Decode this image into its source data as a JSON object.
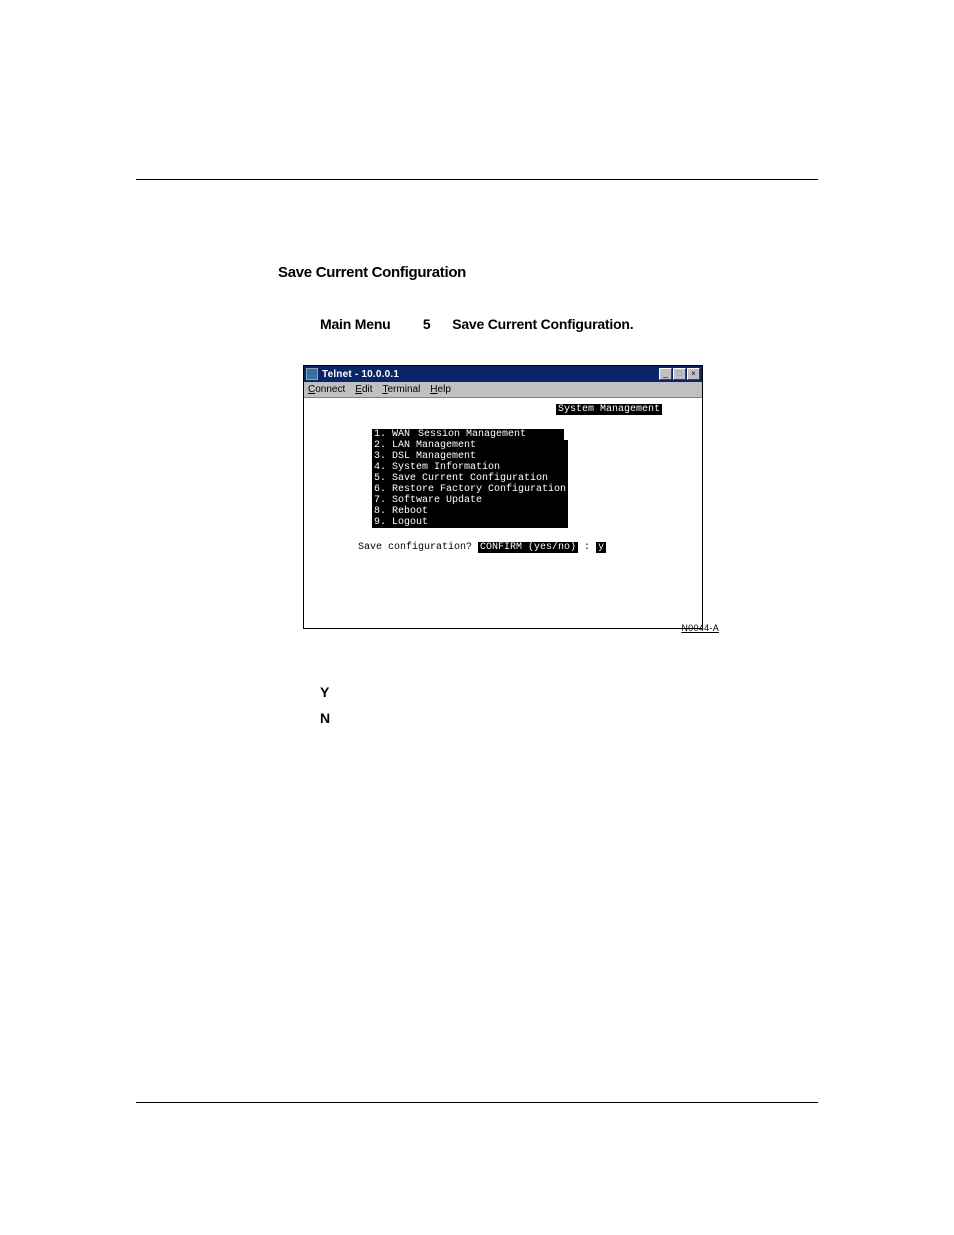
{
  "section": {
    "heading": "Save Current Configuration",
    "menu_path_prefix": "Main Menu",
    "menu_path_num": "5",
    "menu_path_suffix": "Save Current Configuration."
  },
  "telnet": {
    "title": "Telnet - 10.0.0.1",
    "menubar": {
      "connect": "Connect",
      "edit": "Edit",
      "terminal": "Terminal",
      "help": "Help"
    },
    "screen_title": "System Management",
    "items": [
      "WAN Session Management",
      "LAN Management",
      "DSL Management",
      "System Information",
      "Save Current Configuration",
      "Restore Factory Configuration",
      "Software Update",
      "Reboot",
      "Logout"
    ],
    "prompt_prefix": "Save configuration? ",
    "prompt_confirm": "CONFIRM (yes/no)",
    "prompt_colon": " : ",
    "prompt_input": "y",
    "figure_id": "N0044-A",
    "win_min": "_",
    "win_max": "□",
    "win_close": "×"
  },
  "responses": {
    "yes_key": "Y",
    "no_key": "N"
  }
}
